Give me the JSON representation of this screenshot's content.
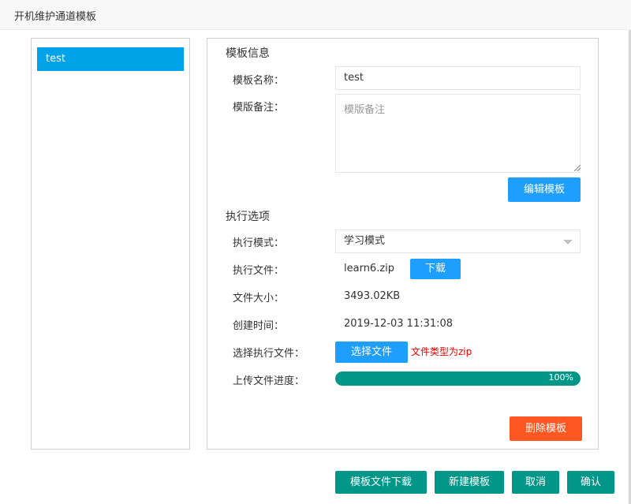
{
  "window": {
    "title": "开机维护通道模板"
  },
  "sidebar": {
    "items": [
      {
        "label": "test",
        "selected": true
      }
    ]
  },
  "template_info": {
    "section_title": "模板信息",
    "name_label": "模板名称：",
    "name_value": "test",
    "remark_label": "模版备注：",
    "remark_placeholder": "模版备注",
    "edit_button": "编辑模板"
  },
  "exec_options": {
    "section_title": "执行选项",
    "mode_label": "执行模式：",
    "mode_value": "学习模式",
    "file_label": "执行文件：",
    "file_value": "learn6.zip",
    "download_button": "下载",
    "size_label": "文件大小：",
    "size_value": "3493.02KB",
    "created_label": "创建时间：",
    "created_value": "2019-12-03 11:31:08",
    "choose_label": "选择执行文件：",
    "choose_button": "选择文件",
    "choose_hint": "文件类型为zip",
    "upload_label": "上传文件进度：",
    "upload_progress": 100,
    "upload_progress_text": "100%",
    "delete_button": "删除模板"
  },
  "footer": {
    "download_template_button": "模板文件下载",
    "new_template_button": "新建模板",
    "cancel_button": "取消",
    "confirm_button": "确认"
  },
  "colors": {
    "primary_blue": "#1e9fff",
    "selected_item": "#00a2e8",
    "danger_orange": "#ff5722",
    "teal": "#009688",
    "hint_red": "#e00000"
  }
}
